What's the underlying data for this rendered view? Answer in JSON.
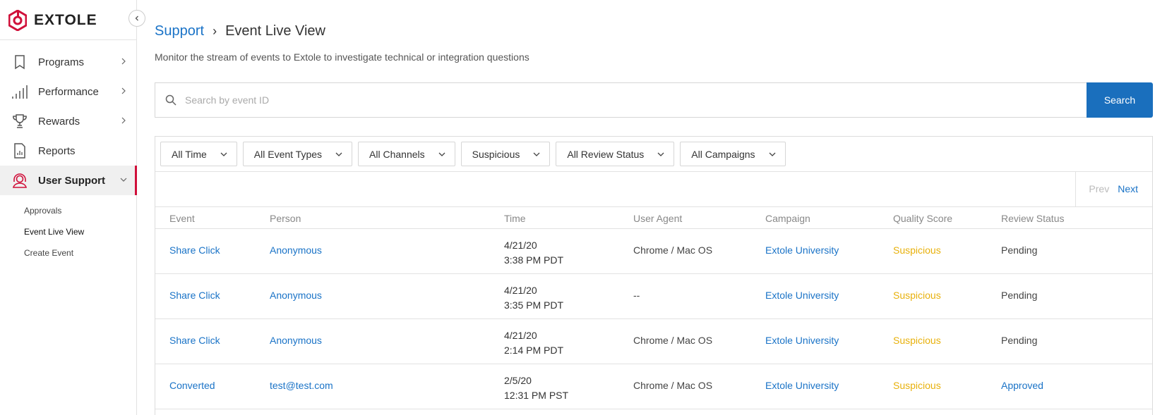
{
  "brand": {
    "name": "EXTOLE",
    "color": "#d0103a"
  },
  "sidebar": {
    "collapse_icon": "chevron-left-icon",
    "items": [
      {
        "label": "Programs",
        "icon": "bookmark-icon",
        "has_chevron": true
      },
      {
        "label": "Performance",
        "icon": "bar-chart-icon",
        "has_chevron": true
      },
      {
        "label": "Rewards",
        "icon": "trophy-icon",
        "has_chevron": true
      },
      {
        "label": "Reports",
        "icon": "report-icon",
        "has_chevron": false
      },
      {
        "label": "User Support",
        "icon": "support-agent-icon",
        "has_chevron": true,
        "active": true
      }
    ],
    "subitems": [
      {
        "label": "Approvals"
      },
      {
        "label": "Event Live View",
        "current": true
      },
      {
        "label": "Create Event"
      }
    ]
  },
  "header": {
    "breadcrumb_parent": "Support",
    "breadcrumb_separator": "›",
    "title": "Event Live View",
    "subtitle": "Monitor the stream of events to Extole to investigate technical or integration questions"
  },
  "search": {
    "placeholder": "Search by event ID",
    "value": "",
    "button_label": "Search"
  },
  "filters": [
    {
      "label": "All Time"
    },
    {
      "label": "All Event Types"
    },
    {
      "label": "All Channels"
    },
    {
      "label": "Suspicious"
    },
    {
      "label": "All Review Status"
    },
    {
      "label": "All Campaigns"
    }
  ],
  "pager": {
    "prev": "Prev",
    "next": "Next"
  },
  "table": {
    "columns": [
      "Event",
      "Person",
      "Time",
      "User Agent",
      "Campaign",
      "Quality Score",
      "Review Status"
    ],
    "rows": [
      {
        "event": "Share Click",
        "person": "Anonymous",
        "date": "4/21/20",
        "time": "3:38 PM PDT",
        "agent": "Chrome / Mac OS",
        "campaign": "Extole University",
        "score": "Suspicious",
        "review": "Pending"
      },
      {
        "event": "Share Click",
        "person": "Anonymous",
        "date": "4/21/20",
        "time": "3:35 PM PDT",
        "agent": "--",
        "campaign": "Extole University",
        "score": "Suspicious",
        "review": "Pending"
      },
      {
        "event": "Share Click",
        "person": "Anonymous",
        "date": "4/21/20",
        "time": "2:14 PM PDT",
        "agent": "Chrome / Mac OS",
        "campaign": "Extole University",
        "score": "Suspicious",
        "review": "Pending"
      },
      {
        "event": "Converted",
        "person": "test@test.com",
        "date": "2/5/20",
        "time": "12:31 PM PST",
        "agent": "Chrome / Mac OS",
        "campaign": "Extole University",
        "score": "Suspicious",
        "review": "Approved"
      }
    ]
  },
  "colors": {
    "link": "#1a73c7",
    "primary_button": "#1a6fbd",
    "warning": "#e8b10c",
    "active_marker": "#d0103a"
  }
}
